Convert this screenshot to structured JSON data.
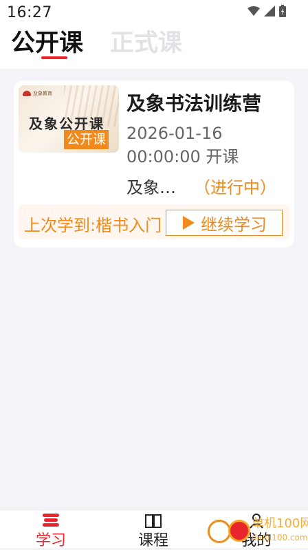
{
  "status_bar": {
    "time": "16:27",
    "icons": [
      "wifi-icon",
      "signal-icon",
      "battery-icon"
    ]
  },
  "header": {
    "tabs": [
      {
        "label": "公开课",
        "active": true
      },
      {
        "label": "正式课",
        "active": false
      }
    ]
  },
  "course": {
    "thumbnail": {
      "logo_text": "及象教育",
      "title": "及象公开课",
      "badge": "公开课"
    },
    "title": "及象书法训练营",
    "date": "2026-01-16",
    "time": "00:00:00 开课",
    "teacher": "及象书法",
    "status": "（进行中）",
    "last_learned": "上次学到:楷书入门",
    "continue_label": "继续学习"
  },
  "bottom_nav": {
    "items": [
      {
        "label": "学习",
        "active": true
      },
      {
        "label": "课程",
        "active": false
      },
      {
        "label": "我的",
        "active": false
      }
    ]
  },
  "watermark": {
    "text_line1": "单机100网",
    "text_line2": "danji100.com"
  },
  "colors": {
    "accent": "#f08a1c",
    "primary_red": "#e9262d",
    "inactive_tab": "#e2e2e6",
    "background": "#f4f4f8"
  }
}
